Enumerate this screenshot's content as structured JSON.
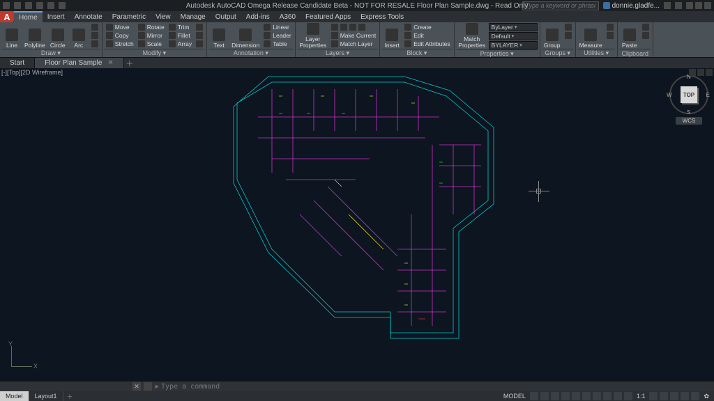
{
  "titlebar": {
    "center": "Autodesk AutoCAD Omega Release Candidate Beta - NOT FOR RESALE    Floor Plan Sample.dwg - Read Only",
    "search_placeholder": "Type a keyword or phrase",
    "user": "donnie.gladfe..."
  },
  "menu": {
    "logo": "A",
    "tabs": [
      "Home",
      "Insert",
      "Annotate",
      "Parametric",
      "View",
      "Manage",
      "Output",
      "Add-ins",
      "A360",
      "Featured Apps",
      "Express Tools"
    ]
  },
  "ribbon": {
    "draw": {
      "title": "Draw ▾",
      "items": [
        "Line",
        "Polyline",
        "Circle",
        "Arc"
      ]
    },
    "modify": {
      "title": "Modify ▾",
      "rows": [
        [
          "Move",
          "Rotate",
          "Trim"
        ],
        [
          "Copy",
          "Mirror",
          "Fillet"
        ],
        [
          "Stretch",
          "Scale",
          "Array"
        ]
      ]
    },
    "annot": {
      "title": "Annotation ▾",
      "big": [
        "Text",
        "Dimension"
      ],
      "rows": [
        "Linear",
        "Leader",
        "Table"
      ]
    },
    "layers": {
      "title": "Layers ▾",
      "big": "Layer Properties",
      "rows": [
        "Make Current",
        "Match Layer"
      ]
    },
    "block": {
      "title": "Block ▾",
      "big": "Insert",
      "rows": [
        "Create",
        "Edit",
        "Edit Attributes"
      ]
    },
    "props": {
      "title": "Properties ▾",
      "big": "Match Properties",
      "layer": "ByLayer",
      "lweight": "Default",
      "ltype": "BYLAYER"
    },
    "groups": {
      "title": "Groups ▾",
      "big": "Group"
    },
    "utils": {
      "title": "Utilities ▾",
      "big": "Measure"
    },
    "clip": {
      "title": "Clipboard",
      "big": "Paste"
    }
  },
  "filetabs": {
    "start": "Start",
    "active": "Floor Plan Sample"
  },
  "viewport": {
    "label": "[-][Top][2D Wireframe]",
    "cube_face": "TOP",
    "cube_dirs": {
      "n": "N",
      "e": "E",
      "s": "S",
      "w": "W"
    },
    "wcs": "WCS",
    "ucs": {
      "x": "X",
      "y": "Y"
    }
  },
  "command": {
    "close": "✕",
    "grip": "⋮",
    "prompt": "▸",
    "placeholder": "Type a command"
  },
  "status": {
    "layouts": [
      "Model",
      "Layout1"
    ],
    "scale": "1:1",
    "gear": "✿"
  }
}
